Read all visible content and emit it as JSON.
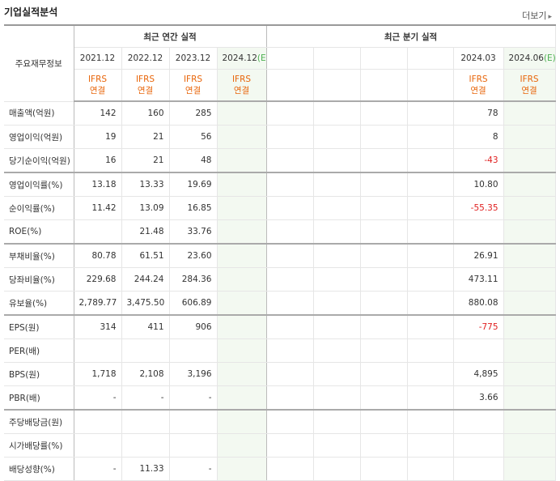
{
  "section_title": "기업실적분석",
  "more_label": "더보기",
  "groups": {
    "label_header": "주요재무정보",
    "annual": "최근 연간 실적",
    "quarterly": "최근 분기 실적"
  },
  "periods": [
    "2021.12",
    "2022.12",
    "2023.12",
    "2024.12",
    "",
    "",
    "",
    "",
    "2024.03",
    "2024.06"
  ],
  "estimate_suffix": "(E)",
  "ifrs_line1": "IFRS",
  "ifrs_line2": "연결",
  "rows": [
    {
      "label": "매출액(억원)",
      "values": [
        "142",
        "160",
        "285",
        "",
        "",
        "",
        "",
        "",
        "78",
        ""
      ]
    },
    {
      "label": "영업이익(억원)",
      "values": [
        "19",
        "21",
        "56",
        "",
        "",
        "",
        "",
        "",
        "8",
        ""
      ]
    },
    {
      "label": "당기순이익(억원)",
      "values": [
        "16",
        "21",
        "48",
        "",
        "",
        "",
        "",
        "",
        "-43",
        ""
      ]
    },
    {
      "label": "영업이익률(%)",
      "values": [
        "13.18",
        "13.33",
        "19.69",
        "",
        "",
        "",
        "",
        "",
        "10.80",
        ""
      ]
    },
    {
      "label": "순이익률(%)",
      "values": [
        "11.42",
        "13.09",
        "16.85",
        "",
        "",
        "",
        "",
        "",
        "-55.35",
        ""
      ]
    },
    {
      "label": "ROE(%)",
      "values": [
        "",
        "21.48",
        "33.76",
        "",
        "",
        "",
        "",
        "",
        "",
        ""
      ]
    },
    {
      "label": "부채비율(%)",
      "values": [
        "80.78",
        "61.51",
        "23.60",
        "",
        "",
        "",
        "",
        "",
        "26.91",
        ""
      ]
    },
    {
      "label": "당좌비율(%)",
      "values": [
        "229.68",
        "244.24",
        "284.36",
        "",
        "",
        "",
        "",
        "",
        "473.11",
        ""
      ]
    },
    {
      "label": "유보율(%)",
      "values": [
        "2,789.77",
        "3,475.50",
        "606.89",
        "",
        "",
        "",
        "",
        "",
        "880.08",
        ""
      ]
    },
    {
      "label": "EPS(원)",
      "values": [
        "314",
        "411",
        "906",
        "",
        "",
        "",
        "",
        "",
        "-775",
        ""
      ]
    },
    {
      "label": "PER(배)",
      "values": [
        "",
        "",
        "",
        "",
        "",
        "",
        "",
        "",
        "",
        ""
      ]
    },
    {
      "label": "BPS(원)",
      "values": [
        "1,718",
        "2,108",
        "3,196",
        "",
        "",
        "",
        "",
        "",
        "4,895",
        ""
      ]
    },
    {
      "label": "PBR(배)",
      "values": [
        "-",
        "-",
        "-",
        "",
        "",
        "",
        "",
        "",
        "3.66",
        ""
      ]
    },
    {
      "label": "주당배당금(원)",
      "values": [
        "",
        "",
        "",
        "",
        "",
        "",
        "",
        "",
        "",
        ""
      ]
    },
    {
      "label": "시가배당률(%)",
      "values": [
        "",
        "",
        "",
        "",
        "",
        "",
        "",
        "",
        "",
        ""
      ]
    },
    {
      "label": "배당성향(%)",
      "values": [
        "-",
        "11.33",
        "-",
        "",
        "",
        "",
        "",
        "",
        "",
        ""
      ]
    }
  ]
}
